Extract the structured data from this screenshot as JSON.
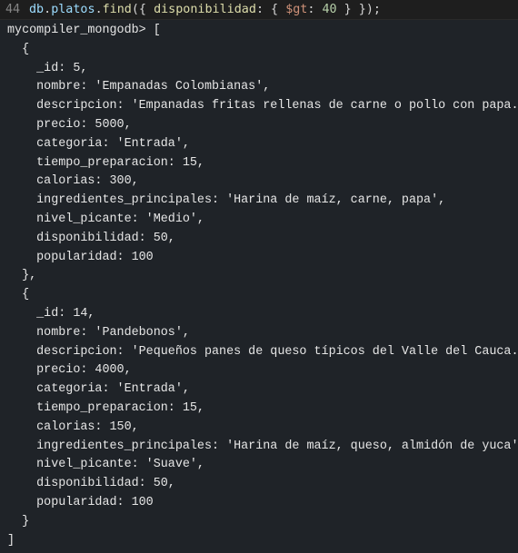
{
  "editor": {
    "line_number": "44",
    "code_obj": "db",
    "code_dot1": ".",
    "code_coll": "platos",
    "code_dot2": ".",
    "code_fn": "find",
    "code_open": "({ ",
    "code_field": "disponibilidad",
    "code_colon": ": { ",
    "code_op": "$gt",
    "code_colon2": ": ",
    "code_value": "40",
    "code_close": " } });"
  },
  "console": {
    "prompt_line": "mycompiler_mongodb> [",
    "lines": [
      "  {",
      "    _id: 5,",
      "    nombre: 'Empanadas Colombianas',",
      "    descripcion: 'Empanadas fritas rellenas de carne o pollo con papa.',",
      "    precio: 5000,",
      "    categoria: 'Entrada',",
      "    tiempo_preparacion: 15,",
      "    calorias: 300,",
      "    ingredientes_principales: 'Harina de maíz, carne, papa',",
      "    nivel_picante: 'Medio',",
      "    disponibilidad: 50,",
      "    popularidad: 100",
      "  },",
      "  {",
      "    _id: 14,",
      "    nombre: 'Pandebonos',",
      "    descripcion: 'Pequeños panes de queso típicos del Valle del Cauca.',",
      "    precio: 4000,",
      "    categoria: 'Entrada',",
      "    tiempo_preparacion: 15,",
      "    calorias: 150,",
      "    ingredientes_principales: 'Harina de maíz, queso, almidón de yuca',",
      "    nivel_picante: 'Suave',",
      "    disponibilidad: 50,",
      "    popularidad: 100",
      "  }",
      "]"
    ]
  }
}
